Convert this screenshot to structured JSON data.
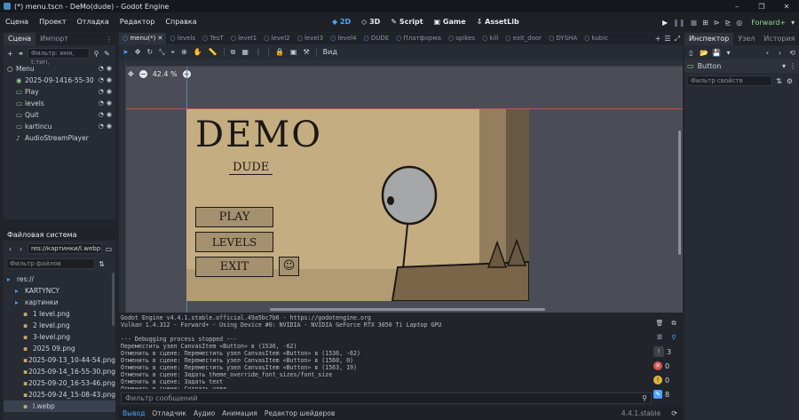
{
  "window": {
    "title": "(*) menu.tscn - DeMo(dude) - Godot Engine",
    "controls": [
      "–",
      "❐",
      "✕"
    ]
  },
  "menubar": {
    "items": [
      "Сцена",
      "Проект",
      "Отладка",
      "Редактор",
      "Справка"
    ],
    "workspaces": [
      "2D",
      "3D",
      "Script",
      "Game",
      "AssetLib"
    ],
    "renderer": "Forward+"
  },
  "left_top": {
    "tabs": [
      "Сцена",
      "Импорт"
    ],
    "filter_placeholder": "Фильтр: имя, t:тип,",
    "nodes": [
      {
        "label": "Menu",
        "icon": "circle-node-icon",
        "color": "#e8eaee"
      },
      {
        "label": "2025-09-1416-55-30",
        "icon": "sprite-icon",
        "color": "#8fd48f"
      },
      {
        "label": "Play",
        "icon": "button-icon",
        "color": "#8fd48f"
      },
      {
        "label": "levels",
        "icon": "button-icon",
        "color": "#8fd48f"
      },
      {
        "label": "Quit",
        "icon": "button-icon",
        "color": "#8fd48f"
      },
      {
        "label": "kartincu",
        "icon": "texture-icon",
        "color": "#8fd48f"
      },
      {
        "label": "AudioStreamPlayer",
        "icon": "audio-icon",
        "color": "#cdd2da"
      }
    ]
  },
  "left_bottom": {
    "title": "Файловая система",
    "path": "res://картинки/l.webp",
    "filter_placeholder": "Фильтр файлов",
    "files": [
      {
        "label": "res://",
        "indent": 0,
        "kind": "folder"
      },
      {
        "label": "KARTYNCY",
        "indent": 1,
        "kind": "folder"
      },
      {
        "label": "картинки",
        "indent": 1,
        "kind": "folder"
      },
      {
        "label": "1 level.png",
        "indent": 2,
        "kind": "image"
      },
      {
        "label": "2 level.png",
        "indent": 2,
        "kind": "image"
      },
      {
        "label": "3-level.png",
        "indent": 2,
        "kind": "image"
      },
      {
        "label": "2025 09.png",
        "indent": 2,
        "kind": "image"
      },
      {
        "label": "2025-09-13_10-44-54.png",
        "indent": 2,
        "kind": "image"
      },
      {
        "label": "2025-09-14_16-55-30.png",
        "indent": 2,
        "kind": "image"
      },
      {
        "label": "2025-09-20_16-53-46.png",
        "indent": 2,
        "kind": "image"
      },
      {
        "label": "2025-09-24_15-08-43.png",
        "indent": 2,
        "kind": "image"
      },
      {
        "label": "l.webp",
        "indent": 2,
        "kind": "image",
        "selected": true
      }
    ]
  },
  "scene_tabs": [
    "menu(*)",
    "levels",
    "TesT",
    "level1",
    "level2",
    "level3",
    "level4",
    "DUDE",
    "Платформа",
    "spikes",
    "kill",
    "exit_door",
    "DYSHA",
    "kubic"
  ],
  "viewport": {
    "zoom": "42.4 %",
    "view_label": "Вид",
    "game_title": "DEMO",
    "game_subtitle": "DUDE",
    "buttons": [
      "PLAY",
      "LEVELS",
      "EXIT"
    ]
  },
  "output": {
    "lines": [
      "Godot Engine v4.4.1.stable.official.49a5bc7b6 - https://godotengine.org",
      "Vulkan 1.4.312 - Forward+ - Using Device #0: NVIDIA - NVIDIA GeForce RTX 3050 Ti Laptop GPU",
      "",
      "--- Debugging process stopped ---",
      "Переместить узел CanvasItem «Button» в (1536, -62)",
      "Отменить в сцене: Переместить узел CanvasItem «Button» в (1536, -62)",
      "Отменить в сцене: Переместить узел CanvasItem «Button» в (1560, 0)",
      "Отменить в сцене: Переместить узел CanvasItem «Button» в (1563, 19)",
      "Отменить в сцене: Задать theme_override_font_sizes/font_size",
      "Отменить в сцене: Задать text",
      "Отменить в сцене: Создать узел"
    ],
    "filter_placeholder": "Фильтр сообщений",
    "counts": {
      "messages": "3",
      "errors": "0",
      "warnings": "0",
      "editor": "8"
    }
  },
  "bottom_tabs": [
    "Вывод",
    "Отладчик",
    "Аудио",
    "Анимация",
    "Редактор шейдеров"
  ],
  "version": "4.4.1.stable",
  "inspector": {
    "tabs": [
      "Инспектор",
      "Узел",
      "История"
    ],
    "object": "Button",
    "filter_placeholder": "Фильтр свойств"
  },
  "colors": {
    "accent": "#4aa3ff",
    "node_green": "#8fd48f",
    "canvas": "#4a4d55",
    "paper": "#c5ad82"
  }
}
